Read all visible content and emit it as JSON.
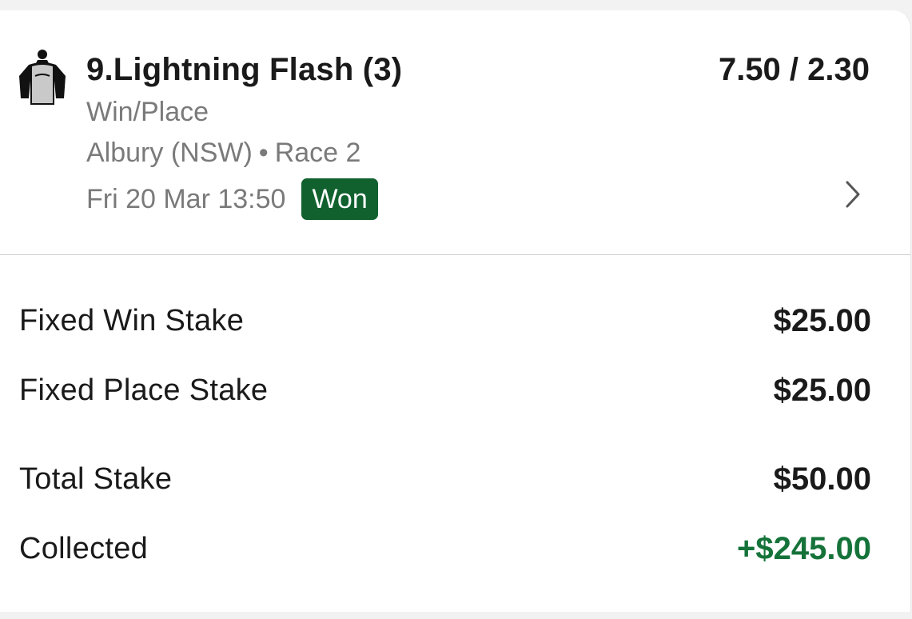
{
  "runner": {
    "title": "9.Lightning Flash (3)",
    "odds": "7.50 / 2.30",
    "bet_type": "Win/Place",
    "venue": "Albury (NSW)",
    "separator": "•",
    "race": "Race 2",
    "datetime": "Fri 20 Mar 13:50",
    "status": "Won",
    "silks_icon": "jockey-silks-icon",
    "chevron_icon": "chevron-right-icon"
  },
  "stakes": [
    {
      "label": "Fixed Win Stake",
      "value": "$25.00"
    },
    {
      "label": "Fixed Place Stake",
      "value": "$25.00"
    },
    {
      "label": "Total Stake",
      "value": "$50.00"
    },
    {
      "label": "Collected",
      "value": "+$245.00"
    }
  ],
  "colors": {
    "won_badge": "#11612f",
    "collected": "#15733a",
    "muted_text": "#7a7a7a"
  }
}
